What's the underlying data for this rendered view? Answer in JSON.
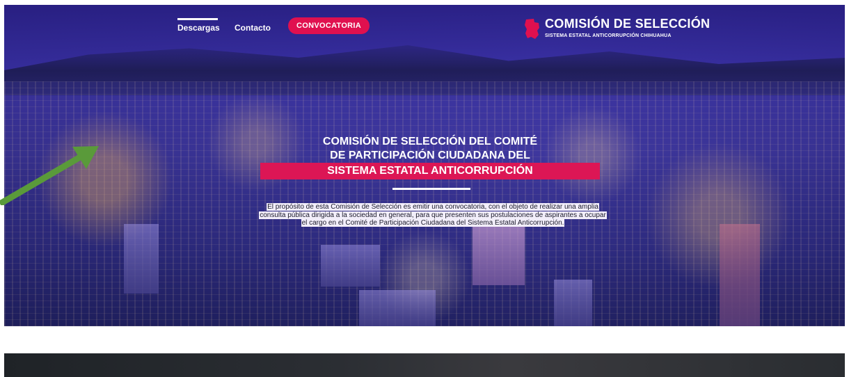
{
  "nav": {
    "items": [
      {
        "label": "Descargas"
      },
      {
        "label": "Contacto"
      }
    ],
    "cta_label": "CONVOCATORIA"
  },
  "logo": {
    "title": "COMISIÓN DE SELECCIÓN",
    "subtitle": "SISTEMA ESTATAL ANTICORRUPCIÓN CHIHUAHUA"
  },
  "hero": {
    "heading_line1": "COMISIÓN DE SELECCIÓN DEL COMITÉ",
    "heading_line2": "DE PARTICIPACIÓN CIUDADANA DEL",
    "heading_highlight": "SISTEMA ESTATAL ANTICORRUPCIÓN",
    "description": "El propósito de esta Comisión de Selección es emitir una convocatoria, con el objeto de realizar una amplia consulta pública dirigida a la sociedad en general, para que presenten sus postulaciones de aspirantes a ocupar el cargo en el Comité de Participación Ciudadana del Sistema Estatal Anticorrupción."
  },
  "colors": {
    "accent": "#e0104f",
    "hero_overlay": "#3a3aa0",
    "annotation_arrow": "#5a9a3a",
    "footer": "#2b2e33"
  },
  "icons": {
    "logo": "chihuahua-map-icon",
    "annotation": "green-arrow-icon"
  }
}
